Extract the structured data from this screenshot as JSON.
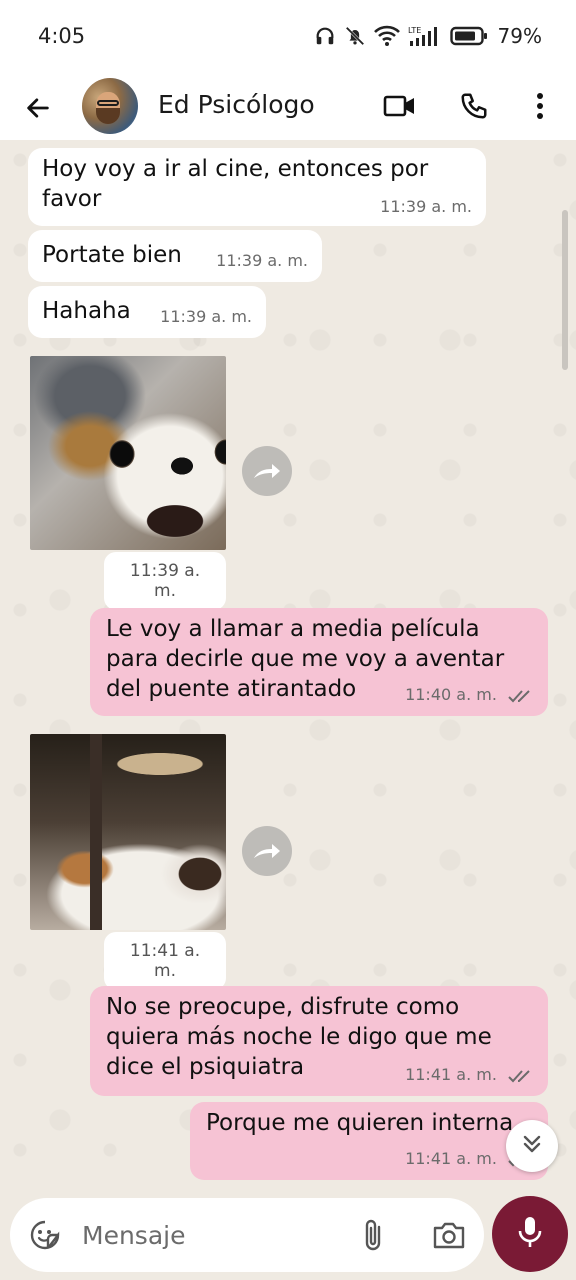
{
  "status_bar": {
    "time": "4:05",
    "battery": "79%",
    "icons": [
      "headphones-icon",
      "mute-bell-icon",
      "wifi-icon",
      "lte-signal-icon",
      "battery-icon"
    ]
  },
  "header": {
    "contact_name": "Ed Psicólogo",
    "icons": [
      "back-arrow-icon",
      "video-call-icon",
      "phone-call-icon",
      "more-options-icon"
    ]
  },
  "messages": [
    {
      "type": "text",
      "direction": "in",
      "text_line1": "Hoy voy a ir al cine, entonces por",
      "text_line2": "favor",
      "time": "11:39 a. m."
    },
    {
      "type": "text",
      "direction": "in",
      "text": "Portate bien",
      "time": "11:39 a. m."
    },
    {
      "type": "text",
      "direction": "in",
      "text": "Hahaha",
      "time": "11:39 a. m."
    },
    {
      "type": "sticker",
      "direction": "in",
      "subject": "dog",
      "time": "11:39 a. m."
    },
    {
      "type": "text",
      "direction": "out",
      "text_line1": "Le voy a llamar a media película",
      "text_line2": "para decirle que me voy a aventar",
      "text_line3": "del puente atirantado",
      "time": "11:40 a. m.",
      "status": "read"
    },
    {
      "type": "sticker",
      "direction": "in",
      "subject": "cat",
      "time": "11:41 a. m."
    },
    {
      "type": "text",
      "direction": "out",
      "text_line1": "No se preocupe, disfrute como",
      "text_line2": "quiera más noche le digo que me",
      "text_line3": "dice el psiquiatra",
      "time": "11:41 a. m.",
      "status": "read"
    },
    {
      "type": "text",
      "direction": "out",
      "text": "Porque me quieren interna",
      "time": "11:41 a. m.",
      "status": "read"
    }
  ],
  "composer": {
    "placeholder": "Mensaje"
  },
  "colors": {
    "outgoing_bubble": "#f6c3d4",
    "incoming_bubble": "#ffffff",
    "chat_background": "#efeae2",
    "mic_button": "#7a1a35",
    "read_ticks": "#6b6b6b"
  }
}
